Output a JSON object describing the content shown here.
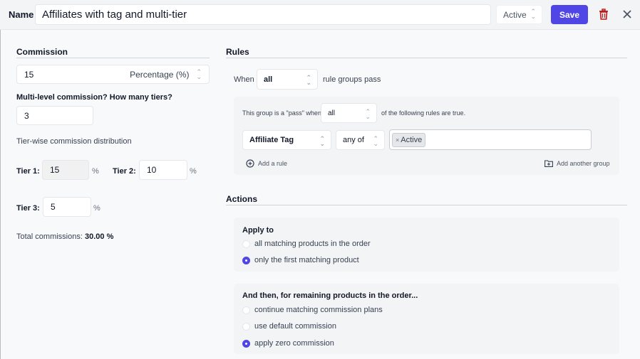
{
  "header": {
    "name_label": "Name",
    "name_value": "Affiliates with tag and multi-tier",
    "status_value": "Active",
    "save_label": "Save"
  },
  "commission": {
    "title": "Commission",
    "amount": "15",
    "type": "Percentage (%)",
    "tiers_question": "Multi-level commission? How many tiers?",
    "tiers_value": "3",
    "distribution_label": "Tier-wise commission distribution",
    "tiers": [
      {
        "label": "Tier 1:",
        "value": "15",
        "unit": "%",
        "disabled": true
      },
      {
        "label": "Tier 2:",
        "value": "10",
        "unit": "%"
      },
      {
        "label": "Tier 3:",
        "value": "5",
        "unit": "%"
      }
    ],
    "total_label": "Total commissions:",
    "total_value": "30.00 %"
  },
  "rules": {
    "title": "Rules",
    "when_label": "When",
    "when_value": "all",
    "when_suffix": "rule groups pass",
    "group": {
      "prefix": "This group is a \"pass\" when",
      "match_value": "all",
      "suffix": "of the following rules are true.",
      "rule": {
        "field": "Affiliate Tag",
        "operator": "any of",
        "tags": [
          "Active"
        ]
      },
      "add_rule_label": "Add a rule",
      "add_group_label": "Add another group"
    }
  },
  "actions": {
    "title": "Actions",
    "apply_to": {
      "title": "Apply to",
      "options": [
        {
          "label": "all matching products in the order",
          "selected": false
        },
        {
          "label": "only the first matching product",
          "selected": true
        }
      ]
    },
    "remaining": {
      "title": "And then, for remaining products in the order...",
      "options": [
        {
          "label": "continue matching commission plans",
          "selected": false
        },
        {
          "label": "use default commission",
          "selected": false
        },
        {
          "label": "apply zero commission",
          "selected": true
        }
      ]
    }
  },
  "colors": {
    "accent": "#5046e5",
    "danger": "#b91c1c",
    "background": "#f8f9fb"
  }
}
